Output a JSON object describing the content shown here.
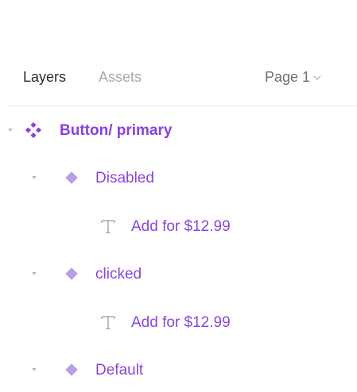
{
  "tabs": {
    "layers": "Layers",
    "assets": "Assets"
  },
  "page_selector": {
    "label": "Page 1"
  },
  "layers": [
    {
      "name": "Button/ primary",
      "type": "component-set",
      "icon": "component-set-icon"
    },
    {
      "name": "Disabled",
      "type": "component",
      "icon": "component-icon"
    },
    {
      "name": "Add for $12.99",
      "type": "text",
      "icon": "text-icon"
    },
    {
      "name": "clicked",
      "type": "component",
      "icon": "component-icon"
    },
    {
      "name": "Add for $12.99",
      "type": "text",
      "icon": "text-icon"
    },
    {
      "name": "Default",
      "type": "component",
      "icon": "component-icon"
    }
  ],
  "colors": {
    "component_purple": "#8a3fe0",
    "component_light": "#b99be6",
    "text_icon_gray": "#9a9a9a",
    "caret_gray": "#bdbdbd"
  }
}
